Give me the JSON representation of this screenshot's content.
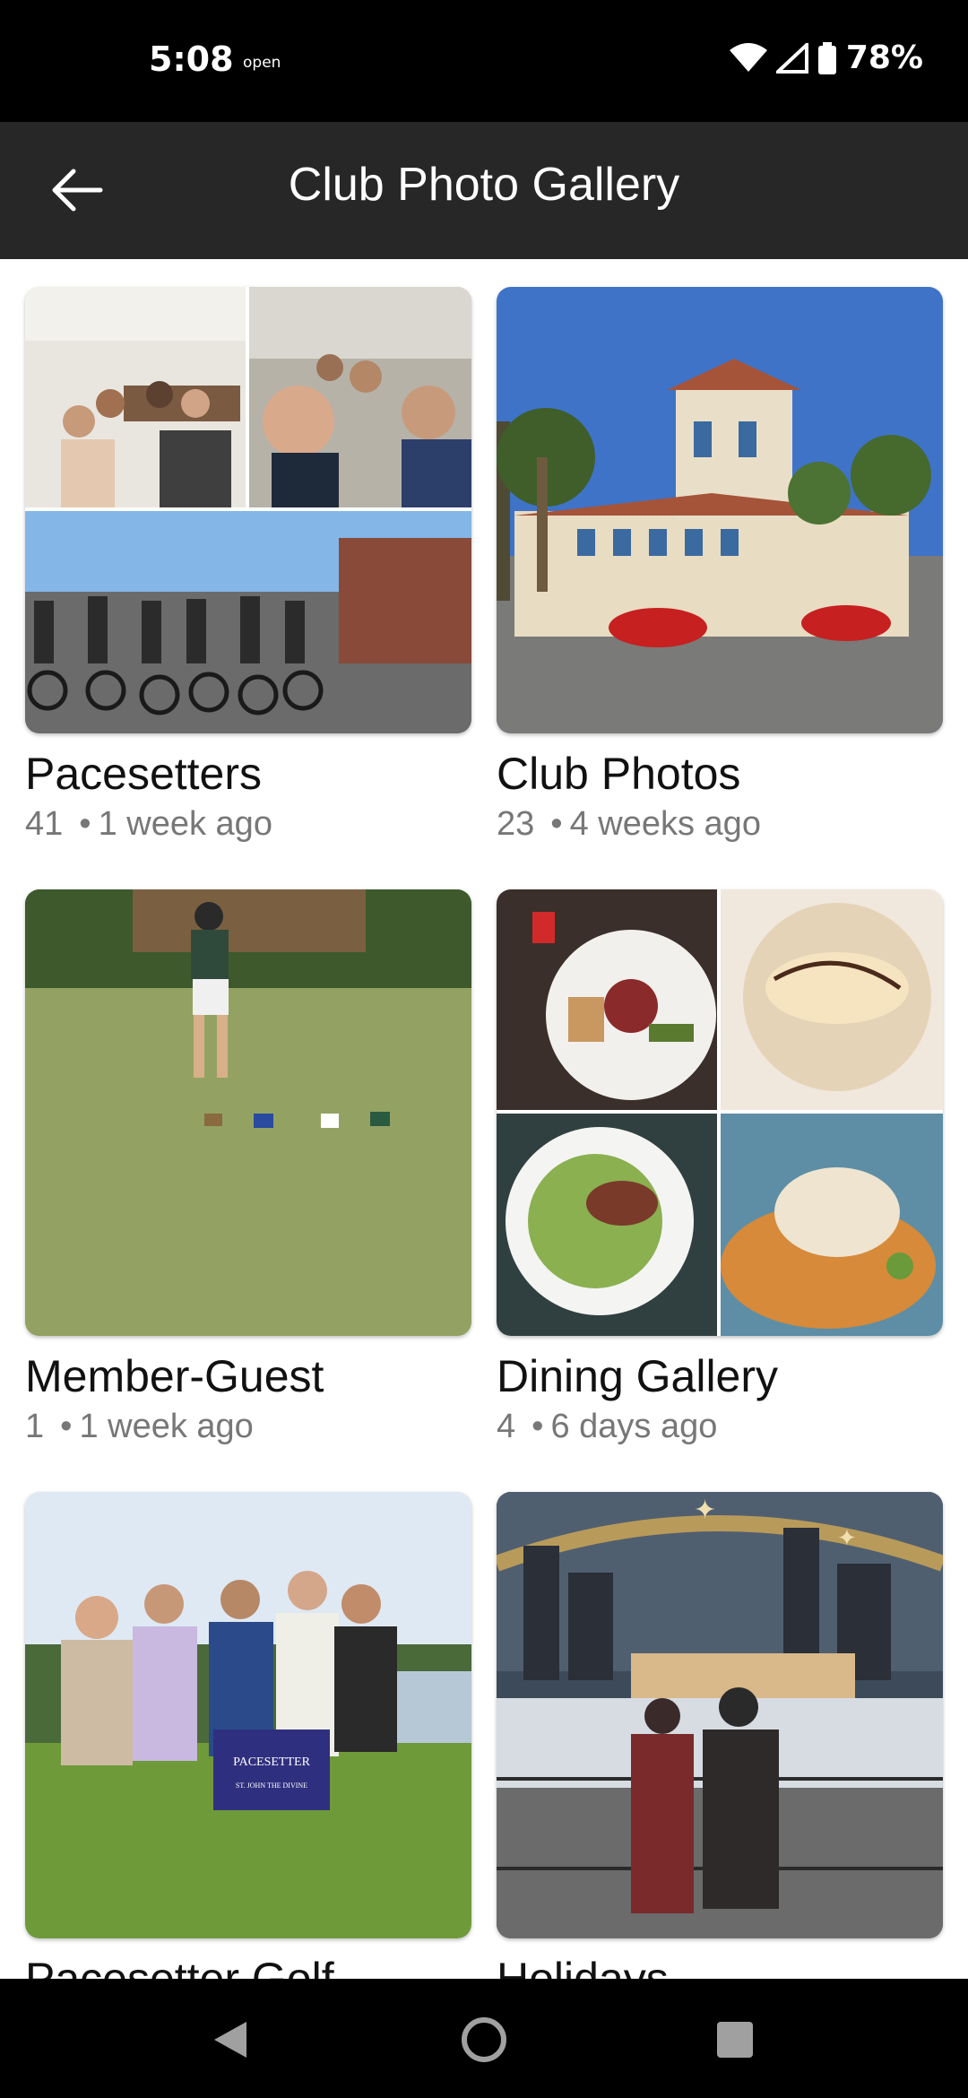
{
  "status": {
    "time": "5:08",
    "open_label": "open",
    "battery": "78%"
  },
  "app_bar": {
    "title": "Club Photo Gallery",
    "back_icon": "arrow-left-icon"
  },
  "albums": [
    {
      "title": "Pacesetters",
      "count": "41",
      "time": "1 week ago"
    },
    {
      "title": "Club Photos",
      "count": "23",
      "time": "4 weeks ago"
    },
    {
      "title": "Member-Guest",
      "count": "1",
      "time": "1 week ago"
    },
    {
      "title": "Dining Gallery",
      "count": "4",
      "time": "6 days ago"
    },
    {
      "title": "Pacesetter Golf",
      "count": "",
      "time": ""
    },
    {
      "title": "Holidays",
      "count": "",
      "time": ""
    }
  ],
  "photo_texts": {
    "sign_main": "PACESETTER",
    "sign_sub": "ST. JOHN THE DIVINE"
  },
  "colors": {
    "app_bar_bg": "#272727",
    "status_bar_bg": "#000000",
    "meta_text": "#777777"
  }
}
